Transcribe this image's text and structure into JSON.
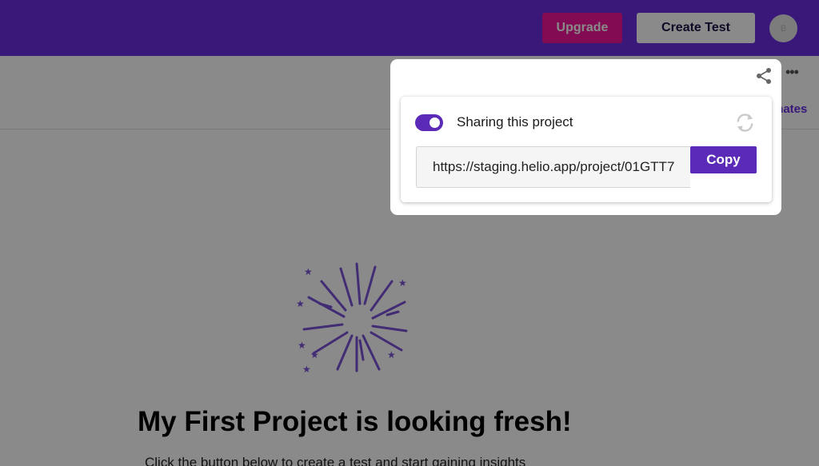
{
  "header": {
    "upgrade_label": "Upgrade",
    "create_test_label": "Create Test",
    "avatar_initial": "B"
  },
  "subheader": {
    "teammates_link": "mates"
  },
  "empty_state": {
    "title": "My First Project is looking fresh!",
    "subtitle": "Click the button below to create a test and start gaining insights"
  },
  "share_popover": {
    "sharing_enabled": true,
    "sharing_label": "Sharing this project",
    "url": "https://staging.helio.app/project/01GTT7",
    "copy_label": "Copy"
  },
  "icons": {
    "share": "share-icon",
    "refresh": "refresh-icon",
    "more": "more-horizontal-icon",
    "illustration": "fireworks-icon"
  },
  "colors": {
    "brand_purple": "#6a2de0",
    "accent_purple": "#5b2bb8",
    "upgrade_pink": "#f0169a"
  }
}
